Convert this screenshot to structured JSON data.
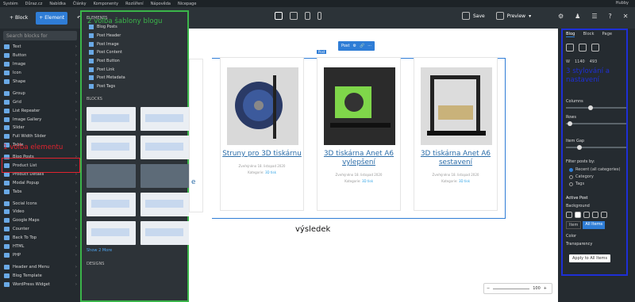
{
  "topbar": {
    "items": [
      "Systém",
      "Důraz.cz",
      "Nabídka",
      "Články",
      "Komponenty",
      "Rozšíření",
      "Nápověda",
      "Nicepage"
    ],
    "user": "Hubby"
  },
  "toolbar": {
    "block_label": "Block",
    "element_label": "Element",
    "save_label": "Save",
    "preview_label": "Preview"
  },
  "left_panel": {
    "search_placeholder": "Search blocks for",
    "items": [
      {
        "label": "Text"
      },
      {
        "label": "Button"
      },
      {
        "label": "Image"
      },
      {
        "label": "Icon"
      },
      {
        "label": "Shape"
      },
      {
        "label": "Group"
      },
      {
        "label": "Grid"
      },
      {
        "label": "List Repeater"
      },
      {
        "label": "Image Gallery"
      },
      {
        "label": "Slider"
      },
      {
        "label": "Full Width Slider"
      },
      {
        "label": "Table"
      },
      {
        "label": "Blog Posts"
      },
      {
        "label": "Product List"
      },
      {
        "label": "Product Details"
      },
      {
        "label": "Modal Popup"
      },
      {
        "label": "Tabs"
      },
      {
        "label": "Social Icons"
      },
      {
        "label": "Video"
      },
      {
        "label": "Google Maps"
      },
      {
        "label": "Counter"
      },
      {
        "label": "Back To Top"
      },
      {
        "label": "HTML"
      },
      {
        "label": "PHP"
      },
      {
        "label": "Header and Menu"
      },
      {
        "label": "Blog Template"
      },
      {
        "label": "WordPress Widget"
      }
    ]
  },
  "sub_panel": {
    "elements_header": "ELEMENTS",
    "elements": [
      "Blog Posts",
      "Post Header",
      "Post Image",
      "Post Content",
      "Post Button",
      "Post Link",
      "Post Metadata",
      "Post Tags"
    ],
    "blocks_header": "BLOCKS",
    "show_more": "Show 2 More",
    "designs_header": "DESIGNS"
  },
  "canvas": {
    "post_badge": "Post",
    "post_tag": "Post",
    "result_label": "výsledek",
    "cards": [
      {
        "title": "Struny pro 3D tiskárnu",
        "meta": "Zveřejněno 18. listopad 2020",
        "category_prefix": "Kategorie:",
        "category": "3D tisk"
      },
      {
        "title": "3D tiskárna Anet A6 vylepšení",
        "meta": "Zveřejněno 18. listopad 2020",
        "category_prefix": "Kategorie:",
        "category": "3D tisk"
      },
      {
        "title": "3D tiskárna Anet A6 sestavení",
        "meta": "Zveřejněno 18. listopad 2020",
        "category_prefix": "Kategorie:",
        "category": "3D tisk"
      }
    ],
    "partial_card_text": "e",
    "zoom_value": "100"
  },
  "right_panel": {
    "tabs": [
      "Blog",
      "Block",
      "Page"
    ],
    "w_label": "W",
    "w_value": "1140",
    "h_value": "493",
    "columns_label": "Columns",
    "rows_label": "Rows",
    "item_gap_label": "Item Gap",
    "filter_label": "Filter posts by:",
    "filter_options": [
      "Recent (all categories)",
      "Category",
      "Tags"
    ],
    "active_post_label": "Active Post",
    "background_label": "Background",
    "item_label": "Item",
    "all_items_label": "All Items",
    "color_label": "Color",
    "transparency_label": "Transparency",
    "apply_button": "Apply to All Items"
  },
  "annotations": {
    "a1": "1 volba elementu",
    "a2": "2 volba šablony blogu",
    "a3_line1": "3 stylování a",
    "a3_line2": "nastavení"
  },
  "colors": {
    "green": "#3bb54a",
    "red": "#e0232f",
    "blue": "#1e2fd6",
    "link": "#2a6ca8"
  }
}
